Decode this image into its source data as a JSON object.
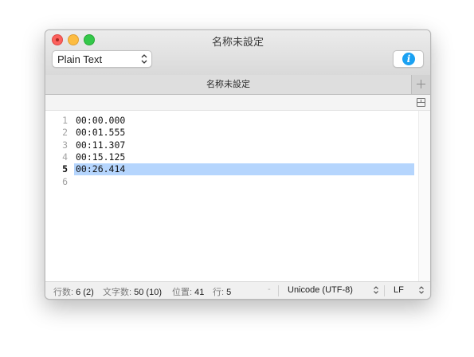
{
  "window": {
    "title": "名称未設定",
    "traffic_lights": {
      "close": "#fc605c",
      "minimize": "#fdbc40",
      "maximize": "#34c84a"
    }
  },
  "toolbar": {
    "syntax_value": "Plain Text",
    "info_icon": "info-icon",
    "info_glyph": "i"
  },
  "tabs": [
    {
      "label": "名称未設定",
      "active": true
    }
  ],
  "editor": {
    "current_line": 5,
    "selection_color": "#b5d5fd",
    "lines": [
      {
        "number": "1",
        "text": "00:00.000"
      },
      {
        "number": "2",
        "text": "00:01.555"
      },
      {
        "number": "3",
        "text": "00:11.307"
      },
      {
        "number": "4",
        "text": "00:15.125"
      },
      {
        "number": "5",
        "text": "00:26.414"
      },
      {
        "number": "6",
        "text": ""
      }
    ]
  },
  "status": {
    "lines_label": "行数:",
    "lines_value": "6 (2)",
    "chars_label": "文字数:",
    "chars_value": "50 (10)",
    "position_label": "位置:",
    "position_value": "41",
    "row_label": "行:",
    "row_value": "5",
    "dash": "-",
    "encoding": "Unicode (UTF-8)",
    "line_ending": "LF"
  }
}
